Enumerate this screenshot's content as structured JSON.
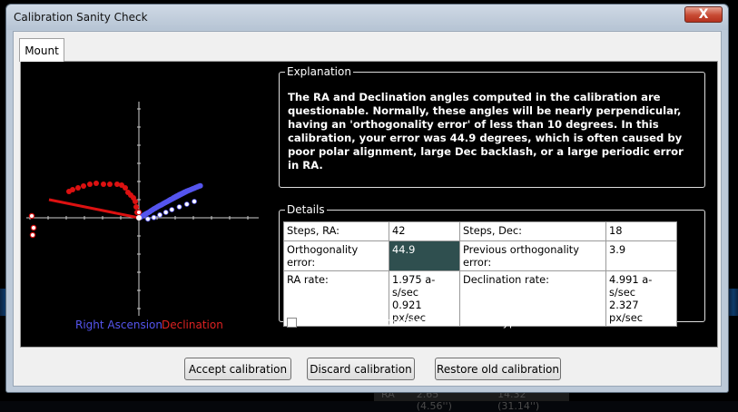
{
  "window": {
    "title": "Calibration Sanity Check",
    "close_label": "X"
  },
  "tabs": [
    {
      "label": "Mount"
    }
  ],
  "legend": {
    "ra": "Right Ascension",
    "dec": "Declination"
  },
  "explanation": {
    "heading": "Explanation",
    "text": "The RA and Declination angles computed in the calibration are questionable. Normally, these angles will be nearly perpendicular, having an 'orthogonality error' of less than 10 degrees.  In this calibration, your error was 44.9 degrees, which is often caused by poor polar alignment, large Dec backlash, or a large periodic error in RA."
  },
  "details": {
    "heading": "Details",
    "rows": [
      {
        "l1": "Steps, RA:",
        "v1": "42",
        "l2": "Steps, Dec:",
        "v2": "18"
      },
      {
        "l1": "Orthogonality error:",
        "v1": "44.9",
        "l2": "Previous orthogonality error:",
        "v2": "3.9"
      },
      {
        "l1": "RA rate:",
        "v1a": "1.975 a-s/sec",
        "v1b": "0.921 px/sec",
        "l2": "Declination rate:",
        "v2a": "4.991 a-s/sec",
        "v2b": "2.327 px/sec"
      }
    ]
  },
  "checkbox": {
    "label": "Don't show calibration alerts of this type",
    "checked": false
  },
  "buttons": {
    "accept": "Accept calibration",
    "discard": "Discard calibration",
    "restore": "Restore old calibration"
  },
  "background_status": {
    "a": "RA",
    "b": "2.65 (4.56'')",
    "c": "14.32 (31.14'')"
  },
  "colors": {
    "ra": "#5555ee",
    "dec": "#dd1111",
    "highlight": "#2f4f4f"
  },
  "plot": {
    "ra_points": [
      [
        0,
        0
      ],
      [
        1,
        0.5
      ],
      [
        2,
        1.6
      ],
      [
        3,
        2.6
      ],
      [
        4,
        3.6
      ],
      [
        5,
        4.6
      ],
      [
        6,
        5.5
      ],
      [
        7,
        6.4
      ],
      [
        8,
        7.6
      ],
      [
        9,
        8.6
      ],
      [
        10,
        9.7
      ],
      [
        11,
        10.6
      ],
      [
        12,
        11.6
      ],
      [
        13,
        12.6
      ],
      [
        14,
        13.5
      ],
      [
        15,
        14.3
      ],
      [
        16,
        15.2
      ],
      [
        17,
        16.2
      ],
      [
        18,
        17.1
      ],
      [
        19,
        18.0
      ],
      [
        20,
        19.0
      ],
      [
        21,
        20.0
      ],
      [
        22,
        20.8
      ],
      [
        23,
        21.9
      ],
      [
        24,
        22.8
      ],
      [
        25,
        23.7
      ],
      [
        26,
        24.5
      ],
      [
        27,
        25.5
      ],
      [
        28,
        26.3
      ],
      [
        29,
        27.0
      ],
      [
        30,
        27.9
      ],
      [
        31,
        28.6
      ],
      [
        32,
        29.4
      ],
      [
        33,
        30.0
      ],
      [
        34,
        30.6
      ],
      [
        35,
        31.2
      ],
      [
        36,
        32.0
      ],
      [
        37,
        32.6
      ],
      [
        38,
        33.4
      ],
      [
        39,
        34.0
      ],
      [
        40,
        34.8
      ],
      [
        41,
        35.3
      ]
    ],
    "ra_return": [
      [
        6,
        -1.3
      ],
      [
        10,
        0.3
      ],
      [
        14,
        3.2
      ],
      [
        18,
        6.0
      ],
      [
        22,
        9.0
      ],
      [
        27,
        12.0
      ],
      [
        32,
        15.0
      ],
      [
        37,
        18.0
      ]
    ],
    "dec_points": [
      [
        0,
        0
      ],
      [
        -2,
        6
      ],
      [
        -3.5,
        12
      ],
      [
        -5,
        18
      ],
      [
        -7,
        22
      ],
      [
        -10,
        25
      ],
      [
        -13,
        28
      ],
      [
        -16,
        33
      ],
      [
        -20,
        36
      ],
      [
        -25,
        37
      ],
      [
        -33,
        37
      ],
      [
        -40,
        37
      ],
      [
        -48,
        38
      ],
      [
        -55,
        37
      ],
      [
        -62,
        35
      ],
      [
        -68,
        33
      ],
      [
        -74,
        31
      ],
      [
        -78,
        29
      ]
    ],
    "dec_return": [
      [
        -60,
        20
      ],
      [
        -122,
        2
      ],
      [
        -118,
        -11
      ],
      [
        -120,
        -18
      ]
    ]
  }
}
